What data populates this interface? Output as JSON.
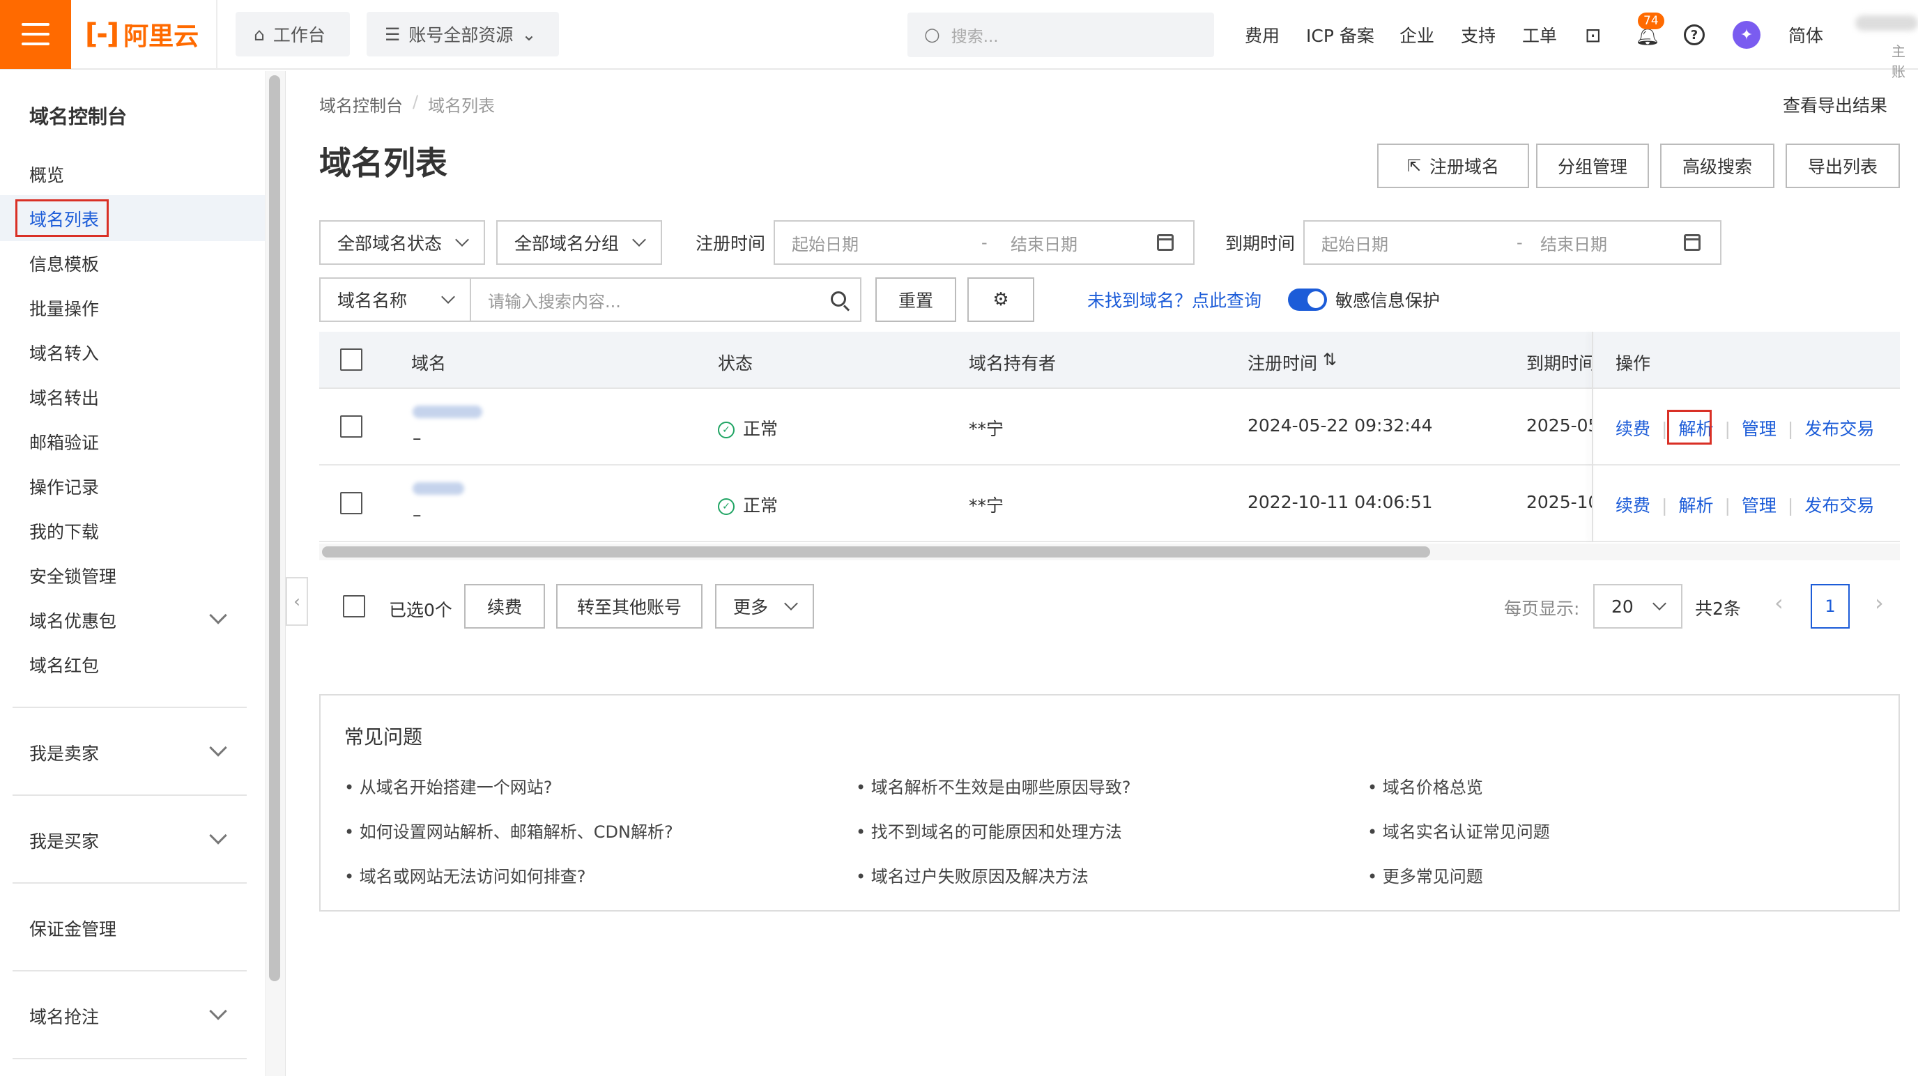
{
  "topbar": {
    "logo_text": "阿里云",
    "workbench": "工作台",
    "resources": "账号全部资源",
    "search_placeholder": "搜索...",
    "nav": [
      "费用",
      "ICP 备案",
      "企业",
      "支持",
      "工单"
    ],
    "notification_count": "74",
    "language": "简体",
    "account_sub": "主账"
  },
  "sidebar": {
    "title": "域名控制台",
    "items": [
      "概览",
      "域名列表",
      "信息模板",
      "批量操作",
      "域名转入",
      "域名转出",
      "邮箱验证",
      "操作记录",
      "我的下载",
      "安全锁管理",
      "域名优惠包",
      "域名红包"
    ],
    "groups": [
      "我是卖家",
      "我是买家",
      "保证金管理",
      "域名抢注"
    ]
  },
  "breadcrumb": [
    "域名控制台",
    "域名列表"
  ],
  "export_result": "查看导出结果",
  "page_title": "域名列表",
  "header_buttons": {
    "register": "注册域名",
    "group": "分组管理",
    "advanced": "高级搜索",
    "export": "导出列表"
  },
  "filters": {
    "status": "全部域名状态",
    "group": "全部域名分组",
    "reg_time_label": "注册时间",
    "exp_time_label": "到期时间",
    "start_date": "起始日期",
    "end_date": "结束日期",
    "dash": "-",
    "name_select": "域名名称",
    "search_placeholder": "请输入搜索内容...",
    "reset": "重置",
    "not_found": "未找到域名？点此查询",
    "privacy": "敏感信息保护"
  },
  "table": {
    "headers": [
      "域名",
      "状态",
      "域名持有者",
      "注册时间",
      "到期时间",
      "操作"
    ],
    "rows": [
      {
        "domain_sub": "–",
        "status": "正常",
        "holder": "**宁",
        "reg_time": "2024-05-22 09:32:44",
        "exp_time": "2025-05"
      },
      {
        "domain_sub": "–",
        "status": "正常",
        "holder": "**宁",
        "reg_time": "2022-10-11 04:06:51",
        "exp_time": "2025-10"
      }
    ],
    "actions": [
      "续费",
      "解析",
      "管理",
      "发布交易"
    ]
  },
  "bulk": {
    "selected": "已选0个",
    "renew": "续费",
    "transfer": "转至其他账号",
    "more": "更多",
    "per_page_label": "每页显示:",
    "per_page": "20",
    "total": "共2条",
    "page": "1"
  },
  "faq": {
    "title": "常见问题",
    "col1": [
      "从域名开始搭建一个网站?",
      "如何设置网站解析、邮箱解析、CDN解析?",
      "域名或网站无法访问如何排查?"
    ],
    "col2": [
      "域名解析不生效是由哪些原因导致?",
      "找不到域名的可能原因和处理方法",
      "域名过户失败原因及解决方法"
    ],
    "col3": [
      "域名价格总览",
      "域名实名认证常见问题",
      "更多常见问题"
    ]
  }
}
